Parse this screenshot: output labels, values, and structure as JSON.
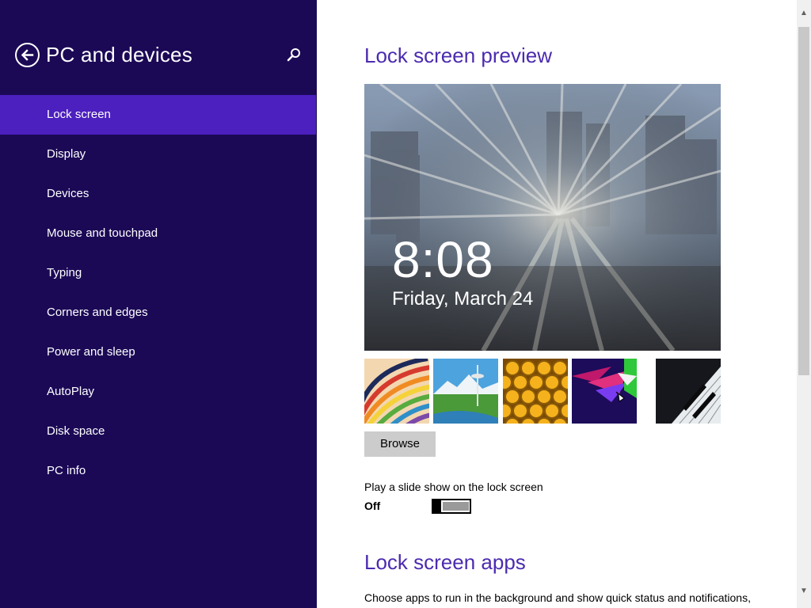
{
  "sidebar": {
    "title": "PC and devices",
    "back_icon": "back-arrow-icon",
    "search_icon": "search-icon",
    "items": [
      {
        "label": "Lock screen",
        "active": true
      },
      {
        "label": "Display"
      },
      {
        "label": "Devices"
      },
      {
        "label": "Mouse and touchpad"
      },
      {
        "label": "Typing"
      },
      {
        "label": "Corners and edges"
      },
      {
        "label": "Power and sleep"
      },
      {
        "label": "AutoPlay"
      },
      {
        "label": "Disk space"
      },
      {
        "label": "PC info"
      }
    ]
  },
  "main": {
    "preview_heading": "Lock screen preview",
    "preview": {
      "time": "8:08",
      "date": "Friday, March 24"
    },
    "thumbnails": [
      "rainbow-stripes",
      "space-needle-landscape",
      "honeycomb",
      "colorful-geometric",
      "piano-keys"
    ],
    "browse_label": "Browse",
    "slideshow": {
      "label": "Play a slide show on the lock screen",
      "state": "Off",
      "on": false
    },
    "apps_heading": "Lock screen apps",
    "apps_description": "Choose apps to run in the background and show quick status and notifications,"
  },
  "colors": {
    "sidebar_bg": "#1b0956",
    "active_item": "#4c1fbf",
    "heading": "#4b2bb0"
  }
}
